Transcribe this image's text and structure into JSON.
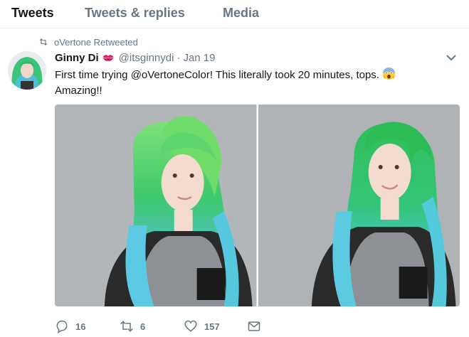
{
  "tabs": [
    {
      "label": "Tweets",
      "active": true
    },
    {
      "label": "Tweets & replies",
      "active": false
    },
    {
      "label": "Media",
      "active": false
    }
  ],
  "retweet": {
    "icon": "retweet-icon",
    "label": "oVertone Retweeted"
  },
  "tweet": {
    "display_name": "Ginny Di",
    "name_emoji": "kiss-mark-icon",
    "handle": "@itsginnydi",
    "separator": "·",
    "timestamp": "Jan 19",
    "text_before": "First time trying ",
    "mention": "@oVertoneColor",
    "text_after": "! This literally took 20 minutes, tops.",
    "text_emoji": "scream-face-icon",
    "text_line2": "Amazing!!",
    "photos": [
      "photo-green-blue-hair-1",
      "photo-green-blue-hair-2"
    ]
  },
  "actions": {
    "reply_count": "16",
    "retweet_count": "6",
    "like_count": "157",
    "dm": ""
  },
  "colors": {
    "text": "#14171a",
    "muted": "#657786",
    "border": "#e6ecf0",
    "hair_green": "#3fc96a",
    "hair_blue": "#5ec8e0"
  }
}
